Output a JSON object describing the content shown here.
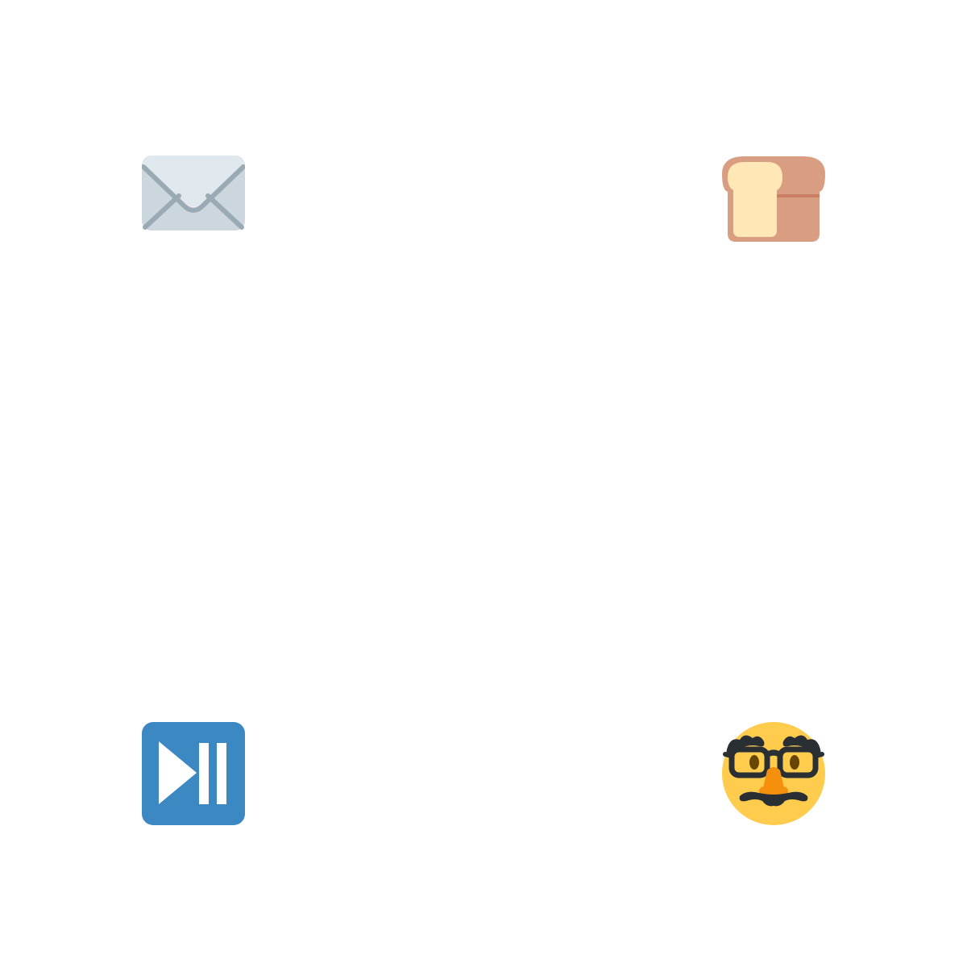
{
  "icons": [
    {
      "name": "envelope-icon",
      "colors": {
        "body": "#CCD6DD",
        "flap": "#E1E8ED",
        "lines": "#99AAB5"
      }
    },
    {
      "name": "bread-icon",
      "colors": {
        "crust": "#D99E82",
        "crumb": "#FFE8B6",
        "seam": "#C1694F"
      }
    },
    {
      "name": "play-pause-icon",
      "colors": {
        "background": "#3B88C3",
        "glyph": "#FFFFFF"
      }
    },
    {
      "name": "disguised-face-icon",
      "colors": {
        "face": "#FFCC4D",
        "features": "#292F33",
        "nose": "#F4900C",
        "eyes": "#664500"
      }
    }
  ]
}
